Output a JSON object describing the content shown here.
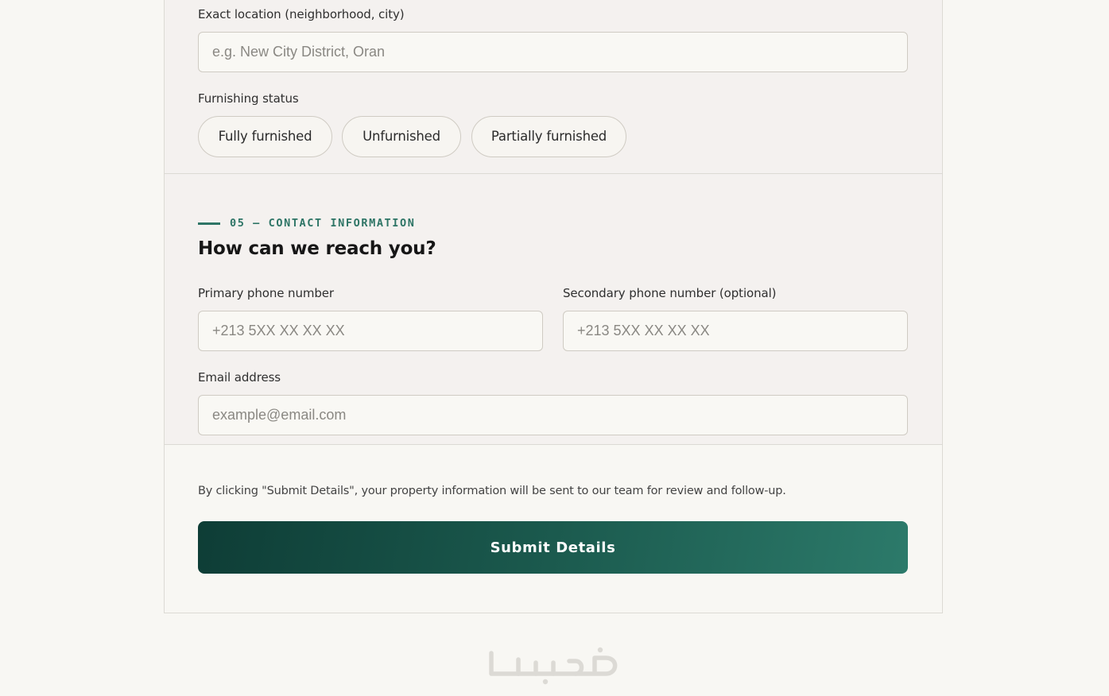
{
  "location": {
    "label": "Exact location (neighborhood, city)",
    "placeholder": "e.g. New City District, Oran"
  },
  "furnishing": {
    "label": "Furnishing status",
    "options": [
      "Fully furnished",
      "Unfurnished",
      "Partially furnished"
    ]
  },
  "contact_section": {
    "eyebrow": "05 — CONTACT INFORMATION",
    "title": "How can we reach you?",
    "primary_phone": {
      "label": "Primary phone number",
      "placeholder": "+213 5XX XX XX XX"
    },
    "secondary_phone": {
      "label": "Secondary phone number (optional)",
      "placeholder": "+213 5XX XX XX XX"
    },
    "email": {
      "label": "Email address",
      "placeholder": "example@email.com"
    }
  },
  "footer": {
    "disclaimer": "By clicking \"Submit Details\", your property information will be sent to our team for review and follow-up.",
    "submit_label": "Submit Details",
    "logo_text": "خمسات"
  },
  "colors": {
    "accent": "#2e7566",
    "button_gradient_start": "#0e3d36",
    "button_gradient_end": "#2c7a6a",
    "page_background": "#f8f7f3",
    "section_background": "#f4f1ef"
  }
}
